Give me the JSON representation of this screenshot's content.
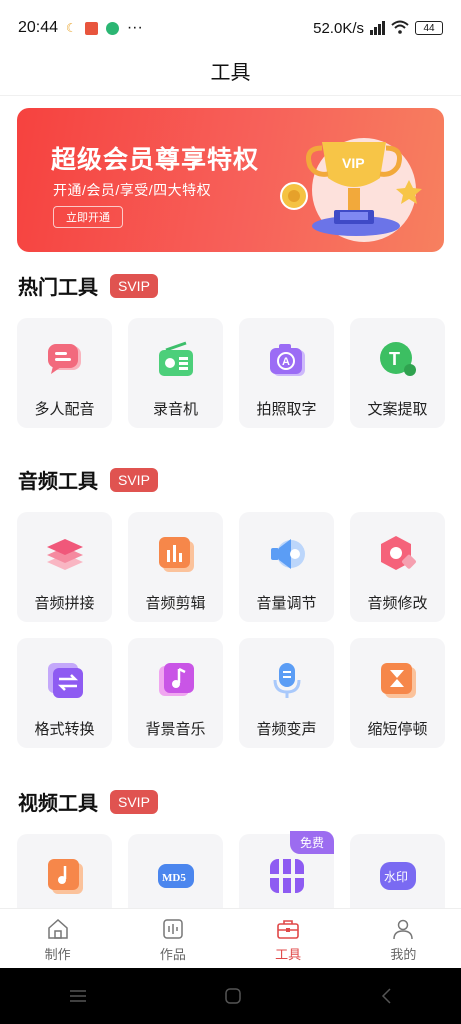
{
  "status_bar": {
    "time": "20:44",
    "net_speed": "52.0K/s",
    "hd": "HD",
    "battery": "44"
  },
  "header": {
    "title": "工具"
  },
  "banner": {
    "title": "超级会员尊享特权",
    "subtitle": "开通/会员/享受/四大特权",
    "button": "立即开通",
    "trophy_text": "VIP"
  },
  "sections": [
    {
      "title": "热门工具",
      "badge": "SVIP",
      "tools": [
        {
          "label": "多人配音",
          "icon": "chat-bubble-icon"
        },
        {
          "label": "录音机",
          "icon": "radio-icon"
        },
        {
          "label": "拍照取字",
          "icon": "camera-text-icon"
        },
        {
          "label": "文案提取",
          "icon": "text-extract-icon"
        }
      ]
    },
    {
      "title": "音频工具",
      "badge": "SVIP",
      "tools": [
        {
          "label": "音频拼接",
          "icon": "layers-icon"
        },
        {
          "label": "音频剪辑",
          "icon": "audio-bars-icon"
        },
        {
          "label": "音量调节",
          "icon": "speaker-icon"
        },
        {
          "label": "音频修改",
          "icon": "hexagon-edit-icon"
        },
        {
          "label": "格式转换",
          "icon": "convert-icon"
        },
        {
          "label": "背景音乐",
          "icon": "music-note-icon"
        },
        {
          "label": "音频变声",
          "icon": "microphone-icon"
        },
        {
          "label": "缩短停顿",
          "icon": "hourglass-icon"
        }
      ]
    },
    {
      "title": "视频工具",
      "badge": "SVIP",
      "tools": [
        {
          "label": "",
          "icon": "video-music-icon"
        },
        {
          "label": "",
          "icon": "md5-icon",
          "icon_text": "MD5"
        },
        {
          "label": "",
          "icon": "grid-icon",
          "badge": "免费"
        },
        {
          "label": "",
          "icon": "watermark-icon",
          "icon_text": "水印"
        }
      ]
    }
  ],
  "bottom_nav": [
    {
      "label": "制作",
      "icon": "home-icon",
      "active": false
    },
    {
      "label": "作品",
      "icon": "works-icon",
      "active": false
    },
    {
      "label": "工具",
      "icon": "toolbox-icon",
      "active": true
    },
    {
      "label": "我的",
      "icon": "profile-icon",
      "active": false
    }
  ],
  "colors": {
    "accent": "#e04848",
    "svip": "#e05350",
    "tile_bg": "#f5f5f7",
    "free_badge": "#9c6cf0"
  }
}
